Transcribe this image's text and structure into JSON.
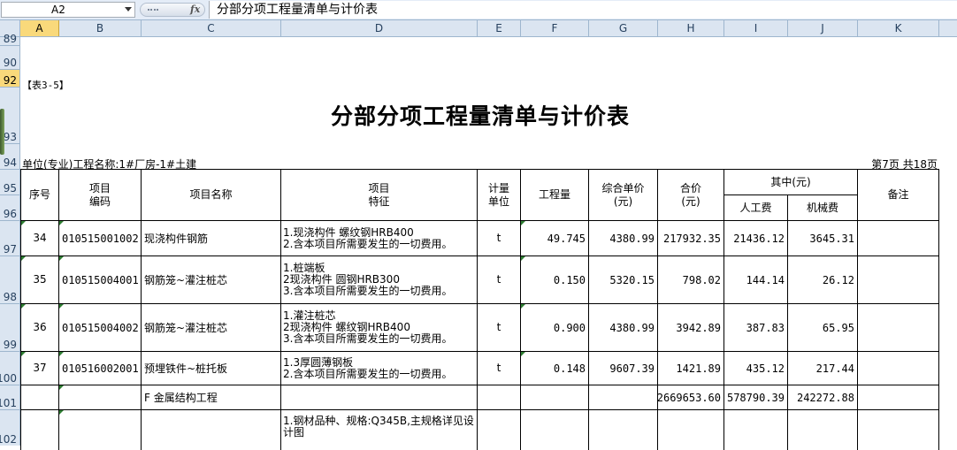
{
  "formula_bar": {
    "name_box": "A2",
    "fx_label": "fx",
    "formula": "分部分项工程量清单与计价表"
  },
  "columns": [
    "A",
    "B",
    "C",
    "D",
    "E",
    "F",
    "G",
    "H",
    "I",
    "J",
    "K"
  ],
  "selected_column": "A",
  "rows": [
    "89",
    "90",
    "92",
    "93",
    "94",
    "95",
    "96",
    "97",
    "98",
    "99",
    "100",
    "101",
    "102"
  ],
  "selected_row": "92",
  "sheet": {
    "table_tag": "【表3-5】",
    "title": "分部分项工程量清单与计价表",
    "unit_line": "单位(专业)工程名称:1#厂房-1#土建",
    "page": "第7页  共18页",
    "headers": {
      "seq": "序号",
      "code": [
        "项目",
        "编码"
      ],
      "name": "项目名称",
      "feature": [
        "项目",
        "特征"
      ],
      "unit": [
        "计量",
        "单位"
      ],
      "qty": "工程量",
      "unit_price": [
        "综合单价",
        "(元)"
      ],
      "total": [
        "合价",
        "(元)"
      ],
      "among": "其中(元)",
      "labor": "人工费",
      "machine": "机械费",
      "note": "备注"
    },
    "items": [
      {
        "seq": "34",
        "code": "010515001002",
        "name": "现浇构件钢筋",
        "features": [
          "1.现浇构件 螺纹钢HRB400",
          "2.含本项目所需要发生的一切费用。"
        ],
        "unit": "t",
        "qty": "49.745",
        "price": "4380.99",
        "total": "217932.35",
        "labor": "21436.12",
        "machine": "3645.31"
      },
      {
        "seq": "35",
        "code": "010515004001",
        "name": "钢筋笼~灌注桩芯",
        "features": [
          "1.桩端板",
          "2现浇构件 圆钢HRB300",
          "3.含本项目所需要发生的一切费用。"
        ],
        "unit": "t",
        "qty": "0.150",
        "price": "5320.15",
        "total": "798.02",
        "labor": "144.14",
        "machine": "26.12"
      },
      {
        "seq": "36",
        "code": "010515004002",
        "name": "钢筋笼~灌注桩芯",
        "features": [
          "1.灌注桩芯",
          "2现浇构件 螺纹钢HRB400",
          "3.含本项目所需要发生的一切费用。"
        ],
        "unit": "t",
        "qty": "0.900",
        "price": "4380.99",
        "total": "3942.89",
        "labor": "387.83",
        "machine": "65.95"
      },
      {
        "seq": "37",
        "code": "010516002001",
        "name": "预埋铁件~桩托板",
        "features": [
          "1.3厚圆薄钢板",
          "2.含本项目所需要发生的一切费用。"
        ],
        "unit": "t",
        "qty": "0.148",
        "price": "9607.39",
        "total": "1421.89",
        "labor": "435.12",
        "machine": "217.44"
      }
    ],
    "subtotal": {
      "name": "F 金属结构工程",
      "total": "2669653.60",
      "labor": "578790.39",
      "machine": "242272.88"
    },
    "last_row": {
      "features": [
        "1.钢材品种、规格:Q345B,主规格详见设",
        "计图"
      ]
    }
  }
}
